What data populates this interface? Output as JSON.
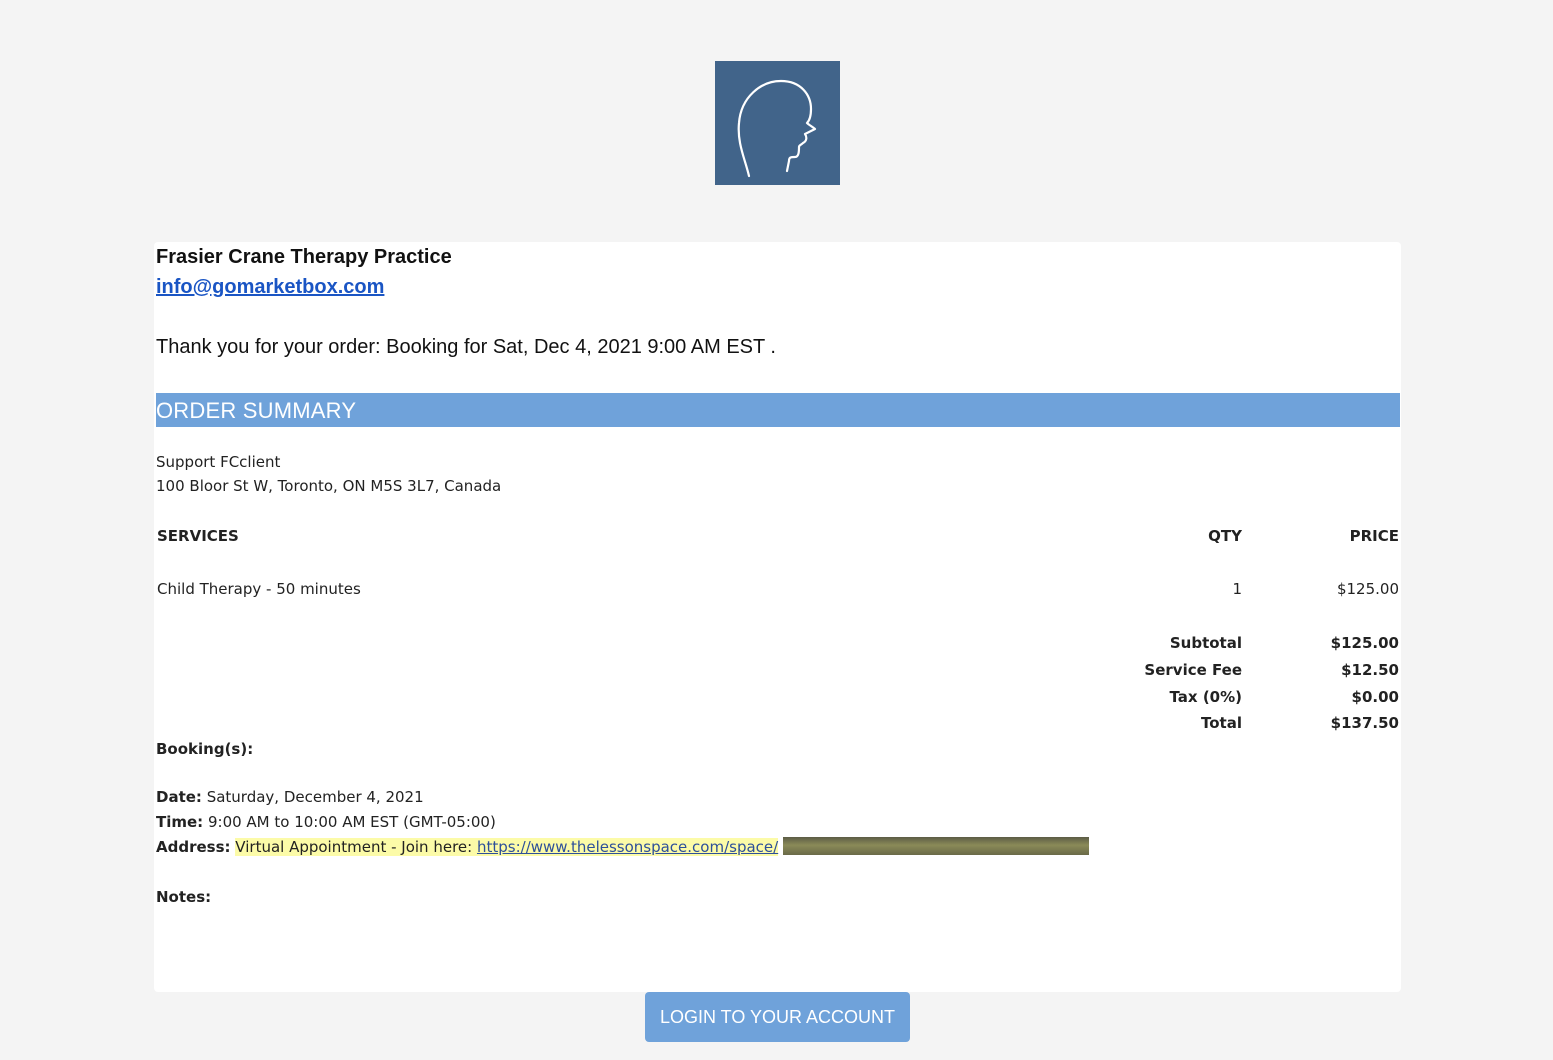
{
  "logo": {
    "icon": "head-profile-icon",
    "bg_color": "#41648a"
  },
  "business": {
    "name": "Frasier Crane Therapy Practice",
    "email": "info@gomarketbox.com"
  },
  "thanks": {
    "text": "Thank you for your order: Booking for Sat, Dec 4, 2021 9:00 AM EST ."
  },
  "summary": {
    "header": "ORDER SUMMARY",
    "header_color": "#6fa2da",
    "customer_name": "Support FCclient",
    "customer_address": "100 Bloor St W, Toronto, ON M5S 3L7, Canada"
  },
  "table": {
    "headers": {
      "services": "SERVICES",
      "qty": "QTY",
      "price": "PRICE"
    },
    "rows": [
      {
        "service": "Child Therapy - 50 minutes",
        "qty": "1",
        "price": "$125.00"
      }
    ],
    "totals": [
      {
        "label": "Subtotal",
        "value": "$125.00"
      },
      {
        "label": "Service Fee",
        "value": "$12.50"
      },
      {
        "label": "Tax (0%)",
        "value": "$0.00"
      },
      {
        "label": "Total",
        "value": "$137.50"
      }
    ]
  },
  "bookings": {
    "heading": "Booking(s):",
    "date_label": "Date:",
    "date_value": "Saturday, December 4, 2021",
    "time_label": "Time:",
    "time_value": "9:00 AM to 10:00 AM EST (GMT-05:00)",
    "address_label": "Address:",
    "address_prefix": "Virtual Appointment - Join here:",
    "address_link": "https://www.thelessonspace.com/space/",
    "notes_label": "Notes:"
  },
  "login_button": {
    "label": "LOGIN TO YOUR ACCOUNT"
  }
}
